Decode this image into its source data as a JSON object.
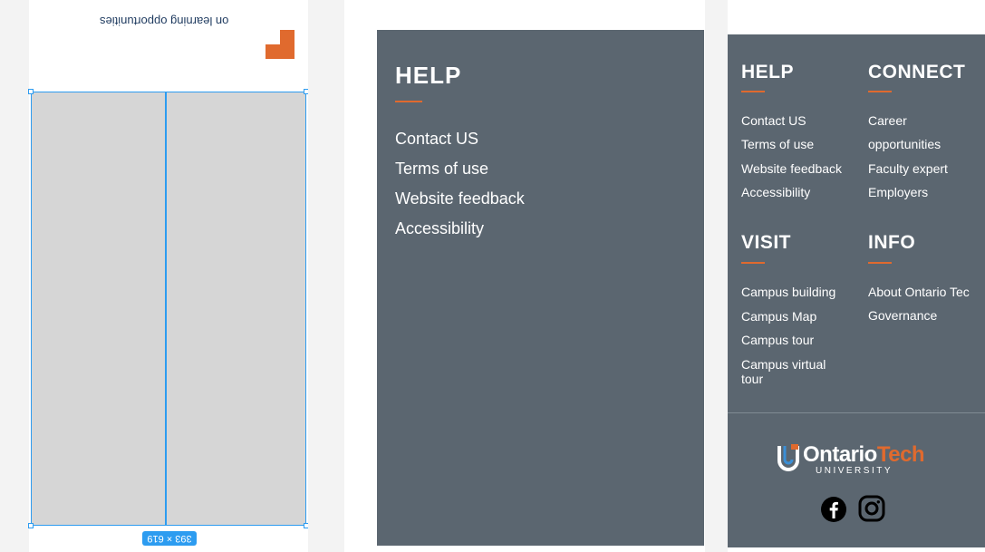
{
  "left_board": {
    "mirrored_text": "on learning opportunities",
    "size_badge": "393 × 619"
  },
  "middle_footer": {
    "heading": "HELP",
    "links": [
      "Contact US",
      "Terms of use",
      "Website feedback",
      "Accessibility"
    ]
  },
  "right_footer": {
    "help": {
      "heading": "HELP",
      "links": [
        "Contact US",
        "Terms of use",
        "Website feedback",
        "Accessibility"
      ]
    },
    "connect": {
      "heading": "CONNECT",
      "links": [
        "Career",
        "opportunities",
        "Faculty expert",
        "Employers"
      ]
    },
    "visit": {
      "heading": "VISIT",
      "links": [
        "Campus building",
        "Campus Map",
        "Campus tour",
        "Campus virtual",
        "tour"
      ]
    },
    "info": {
      "heading": "INFO",
      "links": [
        "About Ontario Tec",
        "Governance"
      ]
    },
    "logo": {
      "word_main": "Ontario",
      "word_accent": "Tech",
      "subtitle": "UNIVERSITY"
    },
    "social": [
      "facebook-icon",
      "instagram-icon"
    ]
  },
  "colors": {
    "panel": "#5b6670",
    "accent": "#e06a2e",
    "selection": "#2d9cf0"
  }
}
